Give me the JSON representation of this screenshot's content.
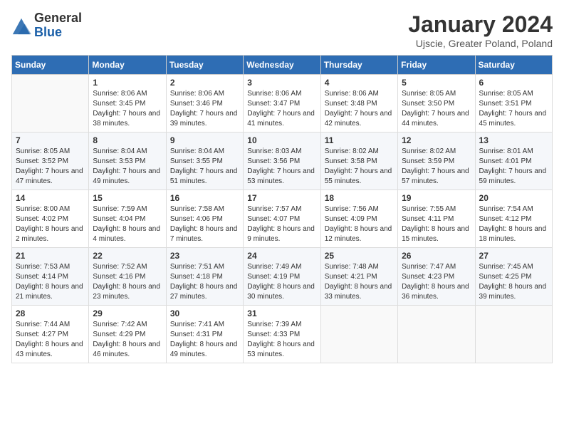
{
  "header": {
    "logo_general": "General",
    "logo_blue": "Blue",
    "month_title": "January 2024",
    "location": "Ujscie, Greater Poland, Poland"
  },
  "weekdays": [
    "Sunday",
    "Monday",
    "Tuesday",
    "Wednesday",
    "Thursday",
    "Friday",
    "Saturday"
  ],
  "weeks": [
    [
      {
        "day": "",
        "sunrise": "",
        "sunset": "",
        "daylight": ""
      },
      {
        "day": "1",
        "sunrise": "Sunrise: 8:06 AM",
        "sunset": "Sunset: 3:45 PM",
        "daylight": "Daylight: 7 hours and 38 minutes."
      },
      {
        "day": "2",
        "sunrise": "Sunrise: 8:06 AM",
        "sunset": "Sunset: 3:46 PM",
        "daylight": "Daylight: 7 hours and 39 minutes."
      },
      {
        "day": "3",
        "sunrise": "Sunrise: 8:06 AM",
        "sunset": "Sunset: 3:47 PM",
        "daylight": "Daylight: 7 hours and 41 minutes."
      },
      {
        "day": "4",
        "sunrise": "Sunrise: 8:06 AM",
        "sunset": "Sunset: 3:48 PM",
        "daylight": "Daylight: 7 hours and 42 minutes."
      },
      {
        "day": "5",
        "sunrise": "Sunrise: 8:05 AM",
        "sunset": "Sunset: 3:50 PM",
        "daylight": "Daylight: 7 hours and 44 minutes."
      },
      {
        "day": "6",
        "sunrise": "Sunrise: 8:05 AM",
        "sunset": "Sunset: 3:51 PM",
        "daylight": "Daylight: 7 hours and 45 minutes."
      }
    ],
    [
      {
        "day": "7",
        "sunrise": "Sunrise: 8:05 AM",
        "sunset": "Sunset: 3:52 PM",
        "daylight": "Daylight: 7 hours and 47 minutes."
      },
      {
        "day": "8",
        "sunrise": "Sunrise: 8:04 AM",
        "sunset": "Sunset: 3:53 PM",
        "daylight": "Daylight: 7 hours and 49 minutes."
      },
      {
        "day": "9",
        "sunrise": "Sunrise: 8:04 AM",
        "sunset": "Sunset: 3:55 PM",
        "daylight": "Daylight: 7 hours and 51 minutes."
      },
      {
        "day": "10",
        "sunrise": "Sunrise: 8:03 AM",
        "sunset": "Sunset: 3:56 PM",
        "daylight": "Daylight: 7 hours and 53 minutes."
      },
      {
        "day": "11",
        "sunrise": "Sunrise: 8:02 AM",
        "sunset": "Sunset: 3:58 PM",
        "daylight": "Daylight: 7 hours and 55 minutes."
      },
      {
        "day": "12",
        "sunrise": "Sunrise: 8:02 AM",
        "sunset": "Sunset: 3:59 PM",
        "daylight": "Daylight: 7 hours and 57 minutes."
      },
      {
        "day": "13",
        "sunrise": "Sunrise: 8:01 AM",
        "sunset": "Sunset: 4:01 PM",
        "daylight": "Daylight: 7 hours and 59 minutes."
      }
    ],
    [
      {
        "day": "14",
        "sunrise": "Sunrise: 8:00 AM",
        "sunset": "Sunset: 4:02 PM",
        "daylight": "Daylight: 8 hours and 2 minutes."
      },
      {
        "day": "15",
        "sunrise": "Sunrise: 7:59 AM",
        "sunset": "Sunset: 4:04 PM",
        "daylight": "Daylight: 8 hours and 4 minutes."
      },
      {
        "day": "16",
        "sunrise": "Sunrise: 7:58 AM",
        "sunset": "Sunset: 4:06 PM",
        "daylight": "Daylight: 8 hours and 7 minutes."
      },
      {
        "day": "17",
        "sunrise": "Sunrise: 7:57 AM",
        "sunset": "Sunset: 4:07 PM",
        "daylight": "Daylight: 8 hours and 9 minutes."
      },
      {
        "day": "18",
        "sunrise": "Sunrise: 7:56 AM",
        "sunset": "Sunset: 4:09 PM",
        "daylight": "Daylight: 8 hours and 12 minutes."
      },
      {
        "day": "19",
        "sunrise": "Sunrise: 7:55 AM",
        "sunset": "Sunset: 4:11 PM",
        "daylight": "Daylight: 8 hours and 15 minutes."
      },
      {
        "day": "20",
        "sunrise": "Sunrise: 7:54 AM",
        "sunset": "Sunset: 4:12 PM",
        "daylight": "Daylight: 8 hours and 18 minutes."
      }
    ],
    [
      {
        "day": "21",
        "sunrise": "Sunrise: 7:53 AM",
        "sunset": "Sunset: 4:14 PM",
        "daylight": "Daylight: 8 hours and 21 minutes."
      },
      {
        "day": "22",
        "sunrise": "Sunrise: 7:52 AM",
        "sunset": "Sunset: 4:16 PM",
        "daylight": "Daylight: 8 hours and 23 minutes."
      },
      {
        "day": "23",
        "sunrise": "Sunrise: 7:51 AM",
        "sunset": "Sunset: 4:18 PM",
        "daylight": "Daylight: 8 hours and 27 minutes."
      },
      {
        "day": "24",
        "sunrise": "Sunrise: 7:49 AM",
        "sunset": "Sunset: 4:19 PM",
        "daylight": "Daylight: 8 hours and 30 minutes."
      },
      {
        "day": "25",
        "sunrise": "Sunrise: 7:48 AM",
        "sunset": "Sunset: 4:21 PM",
        "daylight": "Daylight: 8 hours and 33 minutes."
      },
      {
        "day": "26",
        "sunrise": "Sunrise: 7:47 AM",
        "sunset": "Sunset: 4:23 PM",
        "daylight": "Daylight: 8 hours and 36 minutes."
      },
      {
        "day": "27",
        "sunrise": "Sunrise: 7:45 AM",
        "sunset": "Sunset: 4:25 PM",
        "daylight": "Daylight: 8 hours and 39 minutes."
      }
    ],
    [
      {
        "day": "28",
        "sunrise": "Sunrise: 7:44 AM",
        "sunset": "Sunset: 4:27 PM",
        "daylight": "Daylight: 8 hours and 43 minutes."
      },
      {
        "day": "29",
        "sunrise": "Sunrise: 7:42 AM",
        "sunset": "Sunset: 4:29 PM",
        "daylight": "Daylight: 8 hours and 46 minutes."
      },
      {
        "day": "30",
        "sunrise": "Sunrise: 7:41 AM",
        "sunset": "Sunset: 4:31 PM",
        "daylight": "Daylight: 8 hours and 49 minutes."
      },
      {
        "day": "31",
        "sunrise": "Sunrise: 7:39 AM",
        "sunset": "Sunset: 4:33 PM",
        "daylight": "Daylight: 8 hours and 53 minutes."
      },
      {
        "day": "",
        "sunrise": "",
        "sunset": "",
        "daylight": ""
      },
      {
        "day": "",
        "sunrise": "",
        "sunset": "",
        "daylight": ""
      },
      {
        "day": "",
        "sunrise": "",
        "sunset": "",
        "daylight": ""
      }
    ]
  ]
}
